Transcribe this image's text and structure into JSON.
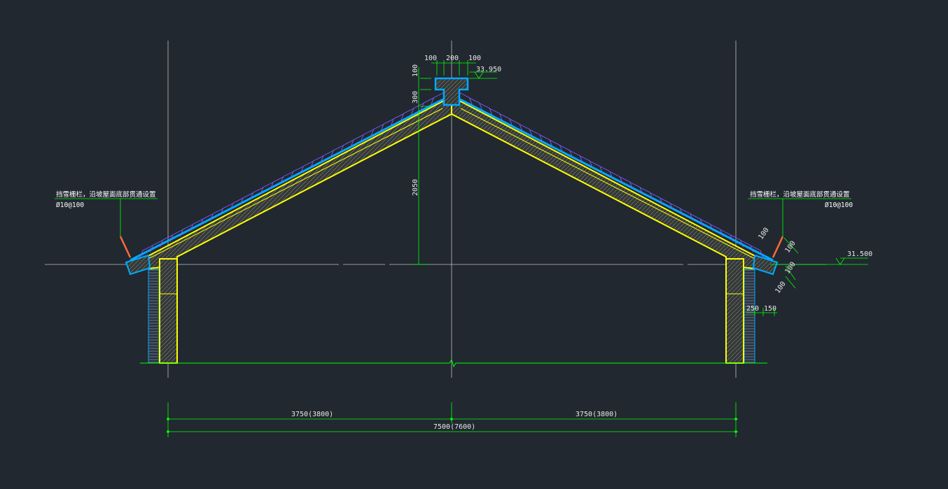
{
  "colors": {
    "background": "#212830",
    "dimension": "#00ff00",
    "axis": "#bfbfbf",
    "slab_outline": "#ffff00",
    "insulation": "#00aaff",
    "tile": "#7a5cff",
    "rebar_leader": "#ff6a3a"
  },
  "dims": {
    "top_left": "100",
    "top_mid": "200",
    "top_right": "100",
    "ridge_level": "33.950",
    "ridge_cap_100": "100",
    "ridge_cap_300": "300",
    "rise": "2050",
    "eave_level": "31.500",
    "eave_100_a": "100",
    "eave_100_b": "100",
    "eave_100_c": "100",
    "eave_100_d": "100",
    "wall_250": "250",
    "wall_150": "150",
    "half_left": "3750(3800)",
    "half_right": "3750(3800)",
    "total": "7500(7600)"
  },
  "notes": {
    "left_title": "挡雪栅栏，沿坡屋面底部贯通设置",
    "left_spec": "Ø10@100",
    "right_title": "挡雪栅栏，沿坡屋面底部贯通设置",
    "right_spec": "Ø10@100"
  }
}
